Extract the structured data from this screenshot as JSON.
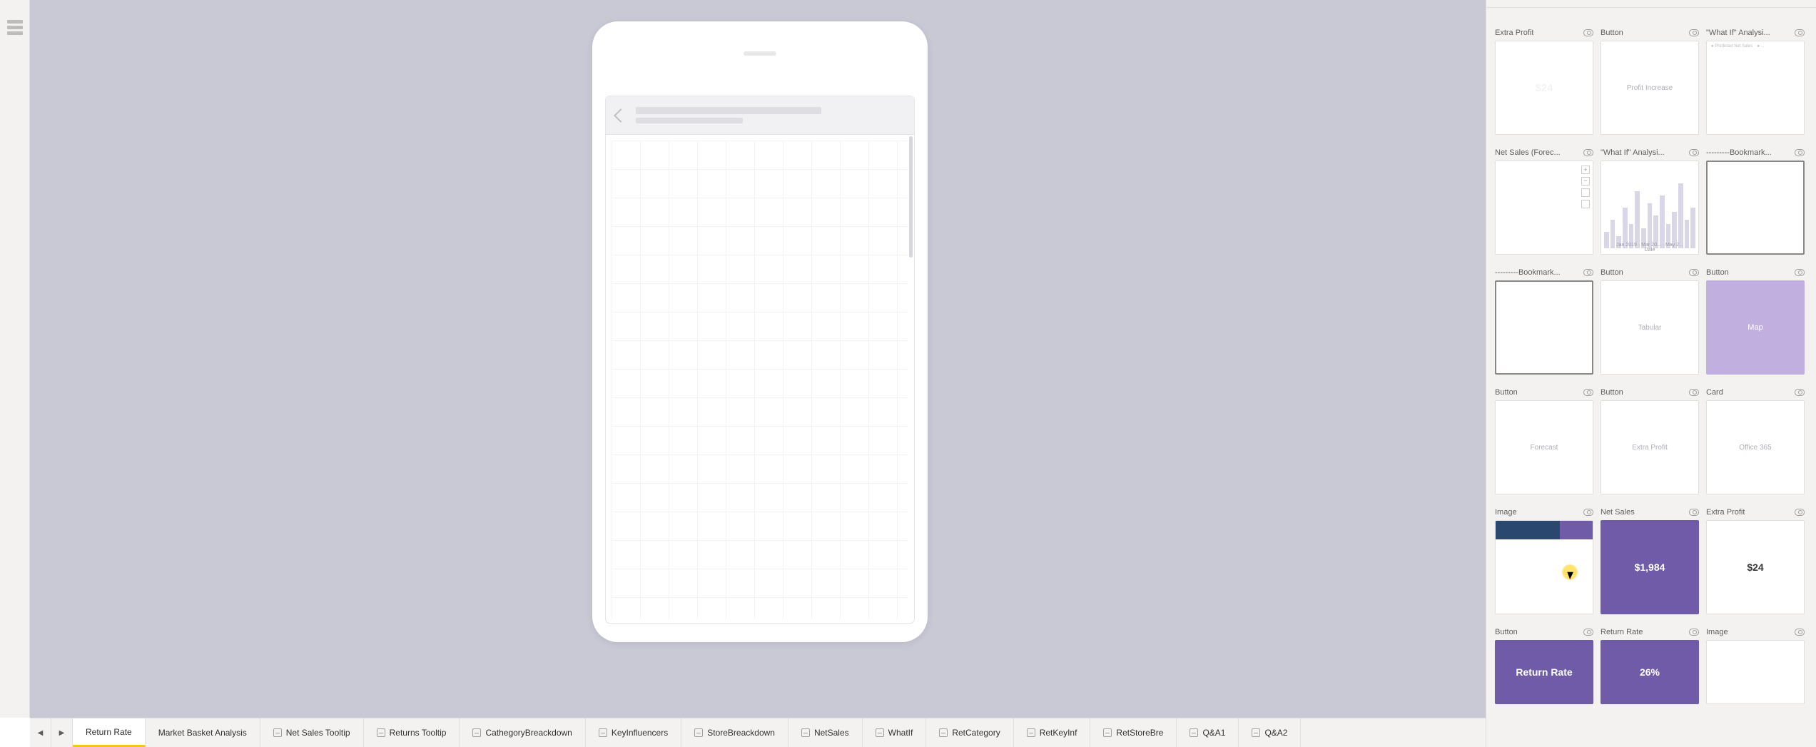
{
  "tabs": {
    "items": [
      {
        "label": "Return Rate",
        "active": true,
        "icon": false
      },
      {
        "label": "Market Basket Analysis",
        "active": false,
        "icon": false
      },
      {
        "label": "Net Sales Tooltip",
        "active": false,
        "icon": true
      },
      {
        "label": "Returns Tooltip",
        "active": false,
        "icon": true
      },
      {
        "label": "CathegoryBreackdown",
        "active": false,
        "icon": true
      },
      {
        "label": "KeyInfluencers",
        "active": false,
        "icon": true
      },
      {
        "label": "StoreBreackdown",
        "active": false,
        "icon": true
      },
      {
        "label": "NetSales",
        "active": false,
        "icon": true
      },
      {
        "label": "WhatIf",
        "active": false,
        "icon": true
      },
      {
        "label": "RetCategory",
        "active": false,
        "icon": true
      },
      {
        "label": "RetKeyInf",
        "active": false,
        "icon": true
      },
      {
        "label": "RetStoreBre",
        "active": false,
        "icon": true
      },
      {
        "label": "Q&A1",
        "active": false,
        "icon": true
      },
      {
        "label": "Q&A2",
        "active": false,
        "icon": true
      }
    ]
  },
  "visuals": {
    "rows": [
      [
        {
          "name": "Extra Profit",
          "content": "$24",
          "style": "faintwhite"
        },
        {
          "name": "Button",
          "content": "Profit Increase",
          "style": "white"
        },
        {
          "name": "\"What If\" Analysi...",
          "content": "",
          "style": "white-legend"
        }
      ],
      [
        {
          "name": "Net Sales (Forec...",
          "content": "",
          "style": "map-thumb"
        },
        {
          "name": "\"What If\" Analysi...",
          "content": "",
          "style": "chart-thumb",
          "xaxis": "Date",
          "xticks": "Jan 2019 · Mar 20... · May 2..."
        },
        {
          "name": "---------Bookmark...",
          "content": "",
          "style": "white-selected"
        }
      ],
      [
        {
          "name": "---------Bookmark...",
          "content": "",
          "style": "white-selected"
        },
        {
          "name": "Button",
          "content": "Tabular",
          "style": "white"
        },
        {
          "name": "Button",
          "content": "Map",
          "style": "purple"
        }
      ],
      [
        {
          "name": "Button",
          "content": "Forecast",
          "style": "white"
        },
        {
          "name": "Button",
          "content": "Extra Profit",
          "style": "white"
        },
        {
          "name": "Card",
          "content": "Office 365",
          "style": "white"
        }
      ],
      [
        {
          "name": "Image",
          "content": "",
          "style": "card-image"
        },
        {
          "name": "Net Sales",
          "content": "$1,984",
          "style": "purple-dark"
        },
        {
          "name": "Extra Profit",
          "content": "$24",
          "style": "white-dark"
        }
      ],
      [
        {
          "name": "Button",
          "content": "Return Rate",
          "style": "purple-dark-tall"
        },
        {
          "name": "Return Rate",
          "content": "26%",
          "style": "purple-dark-tall"
        },
        {
          "name": "Image",
          "content": "",
          "style": "white-tall"
        }
      ]
    ]
  },
  "colors": {
    "purple_light": "#c1afe0",
    "purple_dark": "#6f5ba8",
    "accent_yellow": "#f2c811"
  }
}
